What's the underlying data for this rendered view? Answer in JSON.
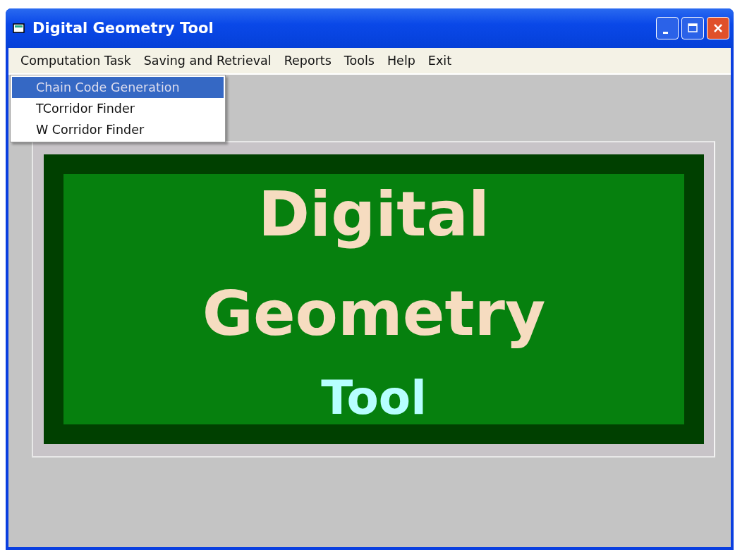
{
  "window": {
    "title": "Digital Geometry Tool"
  },
  "menu": [
    {
      "label": "Computation Task"
    },
    {
      "label": "Saving and Retrieval"
    },
    {
      "label": "Reports"
    },
    {
      "label": "Tools"
    },
    {
      "label": "Help"
    },
    {
      "label": "Exit"
    }
  ],
  "dropdown": [
    {
      "label": "Chain Code Generation",
      "selected": true
    },
    {
      "label": "TCorridor Finder",
      "selected": false
    },
    {
      "label": "W Corridor Finder",
      "selected": false
    }
  ],
  "banner": {
    "lines": [
      {
        "text": "Digital",
        "kind": "title"
      },
      {
        "text": "Geometry",
        "kind": "title"
      },
      {
        "text": "Tool",
        "kind": "subtitle"
      }
    ]
  }
}
